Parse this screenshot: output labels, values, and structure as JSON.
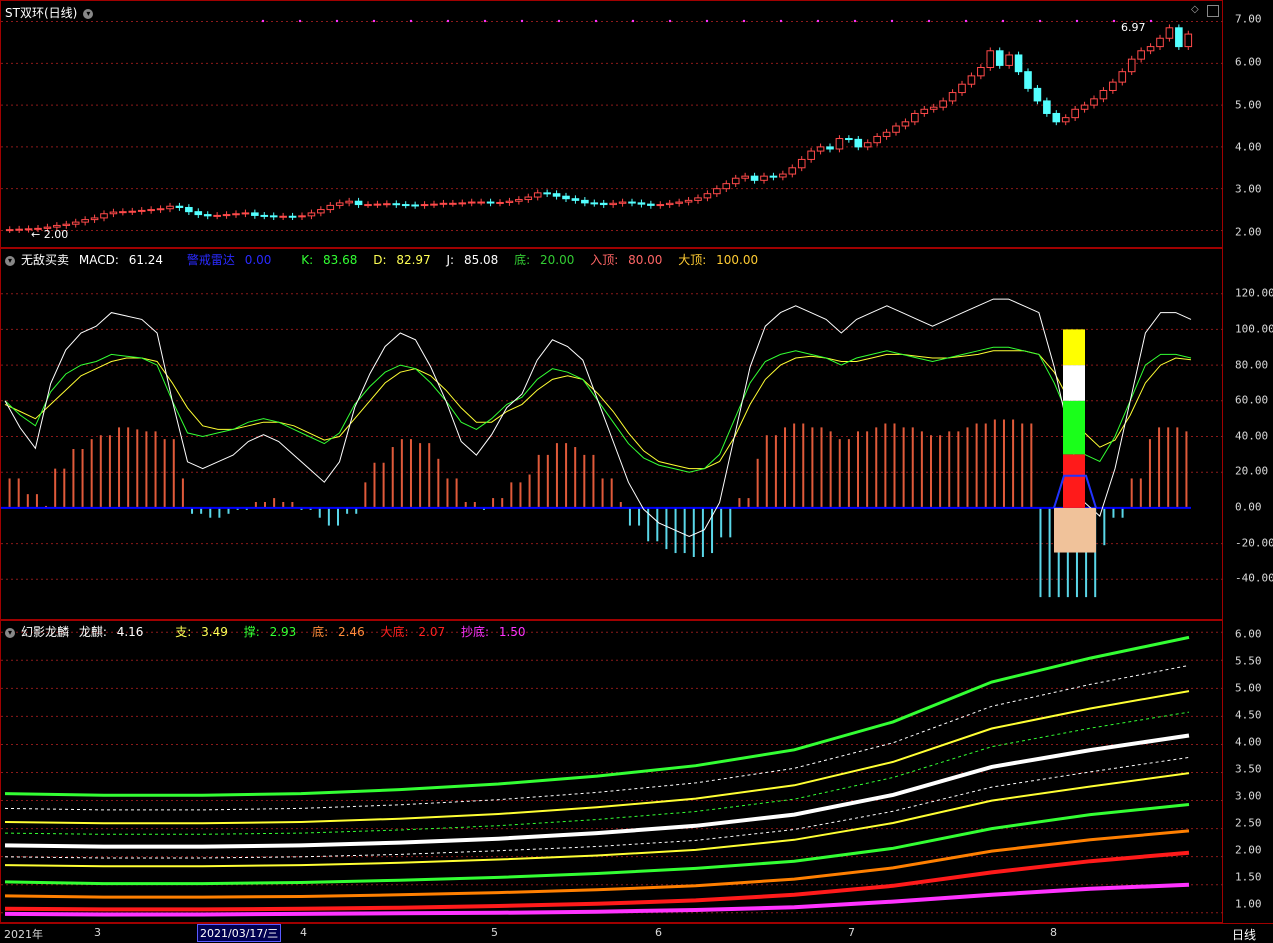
{
  "stock": {
    "title": "ST双环",
    "period": "(日线)",
    "high_label": "6.97",
    "low_label": "2.00"
  },
  "colors": {
    "grid": "#8b1a1a",
    "up": "#ff4a4a",
    "down": "#54ffff",
    "zero": "#0000ff",
    "white": "#ffffff",
    "green": "#33ff33",
    "yellow": "#ffff33",
    "orange": "#ff7f00",
    "red": "#ff1a1a",
    "magenta": "#ff33ff"
  },
  "pane1": {
    "ticks": [
      "7.00",
      "6.00",
      "5.00",
      "4.00",
      "3.00",
      "2.00"
    ]
  },
  "pane2": {
    "name": "无敌买卖",
    "macd_label": "MACD:",
    "macd_value": "61.24",
    "alert_label": "警戒雷达",
    "alert_value": "0.00",
    "k_label": "K:",
    "k_value": "83.68",
    "d_label": "D:",
    "d_value": "82.97",
    "j_label": "J:",
    "j_value": "85.08",
    "bottom_label": "底:",
    "bottom_value": "20.00",
    "top_label": "入顶:",
    "top_value": "80.00",
    "bigtop_label": "大顶:",
    "bigtop_value": "100.00",
    "ticks": [
      "120.00",
      "100.00",
      "80.00",
      "60.00",
      "40.00",
      "20.00",
      "0.00",
      "-20.00",
      "-40.00"
    ]
  },
  "pane3": {
    "name": "幻影龙麟",
    "dragon_label": "龙麒:",
    "dragon_value": "4.16",
    "support_label": "支:",
    "support_value": "3.49",
    "hold_label": "撑:",
    "hold_value": "2.93",
    "bottom_label": "底:",
    "bottom_value": "2.46",
    "bigbottom_label": "大底:",
    "bigbottom_value": "2.07",
    "copy_label": "抄底:",
    "copy_value": "1.50",
    "ticks": [
      "6.00",
      "5.50",
      "5.00",
      "4.50",
      "4.00",
      "3.50",
      "3.00",
      "2.50",
      "2.00",
      "1.50",
      "1.00"
    ]
  },
  "timeline": {
    "year": "2021年",
    "months": [
      "3",
      "4",
      "5",
      "6",
      "7",
      "8"
    ],
    "cursor_date": "2021/03/17/三",
    "period_button": "日线"
  },
  "chart_data": [
    {
      "type": "candlestick",
      "title": "ST双环",
      "ylim": [
        1.7,
        7.3
      ],
      "close_approx": [
        2.02,
        2.03,
        2.04,
        2.05,
        2.08,
        2.12,
        2.15,
        2.2,
        2.26,
        2.3,
        2.4,
        2.44,
        2.45,
        2.46,
        2.48,
        2.5,
        2.52,
        2.58,
        2.55,
        2.45,
        2.38,
        2.35,
        2.36,
        2.38,
        2.4,
        2.42,
        2.36,
        2.35,
        2.33,
        2.34,
        2.33,
        2.35,
        2.42,
        2.5,
        2.6,
        2.66,
        2.7,
        2.62,
        2.62,
        2.63,
        2.64,
        2.62,
        2.61,
        2.6,
        2.62,
        2.63,
        2.65,
        2.65,
        2.66,
        2.68,
        2.68,
        2.66,
        2.67,
        2.7,
        2.74,
        2.8,
        2.9,
        2.88,
        2.82,
        2.76,
        2.72,
        2.66,
        2.65,
        2.62,
        2.65,
        2.68,
        2.66,
        2.63,
        2.6,
        2.62,
        2.65,
        2.68,
        2.72,
        2.78,
        2.88,
        3.0,
        3.12,
        3.25,
        3.3,
        3.2,
        3.3,
        3.28,
        3.35,
        3.5,
        3.7,
        3.9,
        4.0,
        3.95,
        4.2,
        4.18,
        4.0,
        4.1,
        4.25,
        4.35,
        4.5,
        4.6,
        4.8,
        4.9,
        4.95,
        5.1,
        5.3,
        5.5,
        5.7,
        5.9,
        6.3,
        5.95,
        6.2,
        5.8,
        5.4,
        5.1,
        4.8,
        4.6,
        4.7,
        4.9,
        5.0,
        5.15,
        5.35,
        5.55,
        5.8,
        6.1,
        6.3,
        6.4,
        6.6,
        6.85,
        6.4,
        6.7
      ]
    },
    {
      "type": "line",
      "title": "无敌买卖",
      "ylim": [
        -60,
        140
      ],
      "series": [
        {
          "name": "K",
          "values_approx": [
            60,
            52,
            46,
            65,
            75,
            80,
            82,
            86,
            85,
            84,
            80,
            60,
            42,
            40,
            42,
            44,
            48,
            50,
            48,
            44,
            40,
            36,
            42,
            58,
            68,
            76,
            80,
            78,
            70,
            60,
            48,
            44,
            50,
            58,
            62,
            72,
            78,
            76,
            72,
            60,
            48,
            36,
            28,
            24,
            22,
            20,
            22,
            30,
            50,
            70,
            82,
            86,
            88,
            86,
            84,
            80,
            84,
            86,
            88,
            86,
            84,
            82,
            84,
            86,
            88,
            90,
            90,
            88,
            86,
            70,
            50,
            30,
            26,
            40,
            60,
            80,
            86,
            86,
            84
          ]
        },
        {
          "name": "D",
          "values_approx": [
            58,
            54,
            50,
            58,
            66,
            74,
            78,
            82,
            84,
            84,
            82,
            70,
            56,
            46,
            44,
            44,
            46,
            48,
            48,
            46,
            42,
            38,
            40,
            50,
            60,
            70,
            76,
            78,
            74,
            66,
            56,
            48,
            48,
            54,
            58,
            66,
            72,
            74,
            72,
            64,
            54,
            42,
            32,
            26,
            24,
            22,
            22,
            26,
            40,
            58,
            72,
            80,
            84,
            85,
            84,
            82,
            82,
            84,
            86,
            86,
            85,
            84,
            84,
            85,
            86,
            88,
            88,
            88,
            86,
            76,
            60,
            42,
            34,
            38,
            52,
            70,
            80,
            84,
            83
          ]
        }
      ]
    },
    {
      "type": "line",
      "title": "幻影龙麟",
      "ylim": [
        0.8,
        6.2
      ],
      "series": [
        {
          "name": "龙麒",
          "values_approx": [
            2.2,
            2.18,
            2.18,
            2.2,
            2.25,
            2.32,
            2.42,
            2.55,
            2.75,
            3.1,
            3.6,
            3.9,
            4.16
          ]
        },
        {
          "name": "支",
          "values_approx": [
            1.85,
            1.83,
            1.83,
            1.85,
            1.89,
            1.95,
            2.02,
            2.12,
            2.3,
            2.6,
            3.0,
            3.25,
            3.49
          ]
        },
        {
          "name": "撑",
          "values_approx": [
            1.55,
            1.52,
            1.52,
            1.54,
            1.58,
            1.63,
            1.7,
            1.79,
            1.92,
            2.15,
            2.5,
            2.75,
            2.93
          ]
        },
        {
          "name": "底",
          "values_approx": [
            1.3,
            1.28,
            1.28,
            1.29,
            1.32,
            1.36,
            1.41,
            1.48,
            1.6,
            1.8,
            2.1,
            2.3,
            2.46
          ]
        },
        {
          "name": "大底",
          "values_approx": [
            1.07,
            1.06,
            1.06,
            1.07,
            1.09,
            1.12,
            1.16,
            1.22,
            1.32,
            1.48,
            1.72,
            1.92,
            2.07
          ]
        },
        {
          "name": "抄底",
          "values_approx": [
            0.98,
            0.97,
            0.97,
            0.98,
            0.99,
            1.0,
            1.02,
            1.05,
            1.1,
            1.2,
            1.32,
            1.43,
            1.5
          ]
        }
      ]
    }
  ]
}
